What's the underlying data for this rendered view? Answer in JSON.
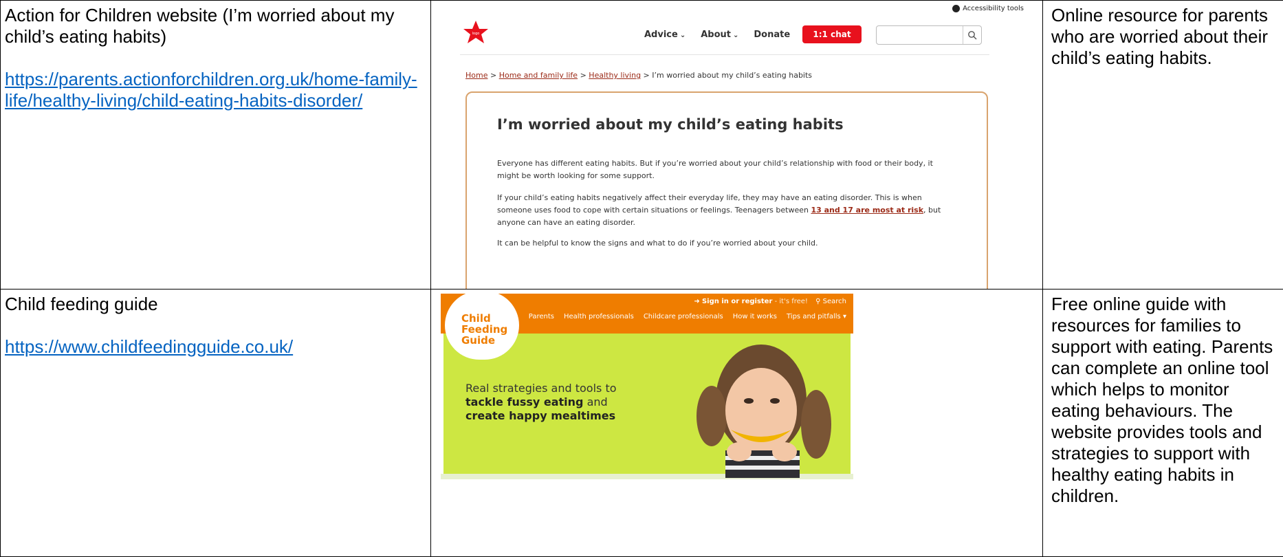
{
  "rows": [
    {
      "title": "Action for Children website (I’m worried about my child’s eating habits)",
      "url": "https://parents.actionforchildren.org.uk/home-family-life/healthy-living/child-eating-habits-disorder/",
      "description": "Online resource for parents who are worried about their child’s eating habits."
    },
    {
      "title": "Child feeding guide",
      "url": "https://www.childfeedingguide.co.uk/",
      "description": "Free online guide with resources for families to support with eating. Parents can complete an online tool which helps to monitor eating behaviours. The website provides tools and strategies to support with healthy eating habits in children."
    }
  ],
  "afc": {
    "accessibility": "Accessibility tools",
    "nav": {
      "advice": "Advice",
      "about": "About",
      "donate": "Donate",
      "chat": "1:1 chat"
    },
    "breadcrumb": [
      "Home",
      "Home and family life",
      "Healthy living",
      "I’m worried about my child’s eating habits"
    ],
    "heading": "I’m worried about my child’s eating habits",
    "p1": "Everyone has different eating habits. But if you’re worried about your child’s relationship with food or their body, it might be worth looking for some support.",
    "p2a": "If your child’s eating habits negatively affect their everyday life, they may have an eating disorder. This is when someone uses food to cope with certain situations or feelings. Teenagers between ",
    "p2link": "13 and 17 are most at risk",
    "p2b": ", but anyone can have an eating disorder.",
    "p3": "It can be helpful to know the signs and what to do if you’re worried about your child.",
    "colors": {
      "red": "#e8111d",
      "link": "#9b2a17",
      "border": "#d9a36d"
    }
  },
  "cfg": {
    "logo": [
      "Child",
      "Feeding",
      "Guide"
    ],
    "signin": "Sign in or register",
    "free": "- it's free!",
    "search": "Search",
    "menu": [
      "Parents",
      "Health professionals",
      "Childcare professionals",
      "How it works",
      "Tips and pitfalls"
    ],
    "tag1": "Real strategies and tools to",
    "tag2_bold": "tackle fussy eating",
    "tag2_rest": " and",
    "tag3": "create happy mealtimes",
    "colors": {
      "orange": "#ef7d00",
      "green": "#cde742"
    }
  }
}
